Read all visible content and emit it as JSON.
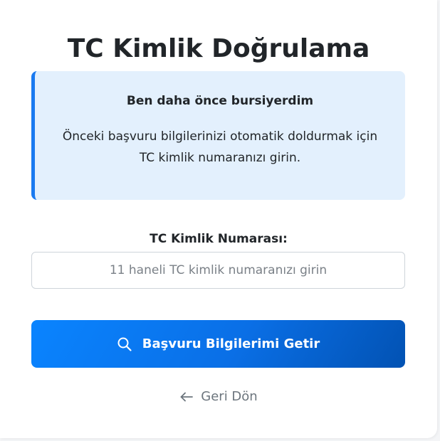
{
  "page": {
    "title": "TC Kimlik Doğrulama"
  },
  "info_box": {
    "heading": "Ben daha önce bursiyerdim",
    "text_line1": "Önceki başvuru bilgilerinizi otomatik doldurmak için",
    "text_line2": "TC kimlik numaranızı girin."
  },
  "form": {
    "tc_label": "TC Kimlik Numarası:",
    "tc_value": "",
    "tc_placeholder": "11 haneli TC kimlik numaranızı girin",
    "submit_label": "Başvuru Bilgilerimi Getir",
    "submit_icon": "search-icon"
  },
  "back": {
    "label": "Geri Dön",
    "icon": "arrow-left-icon"
  },
  "colors": {
    "accent": "#0a6fe6",
    "info_background": "#e3f0fd",
    "info_border": "#1a7af0",
    "muted_text": "#6c757d"
  }
}
